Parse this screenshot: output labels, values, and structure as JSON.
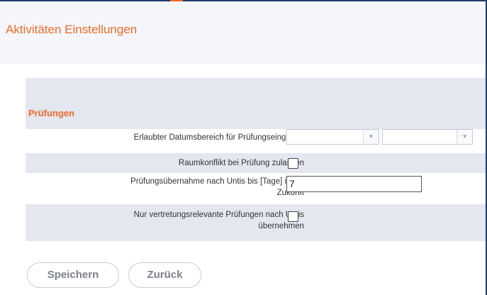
{
  "header": {
    "title": "Aktivitäten Einstellungen"
  },
  "section": {
    "title": "Prüfungen"
  },
  "rows": [
    {
      "label": "Erlaubter Datumsbereich für Prüfungseingaben",
      "control": "date-range",
      "from_value": "",
      "to_value": ""
    },
    {
      "label": "Raumkonflikt bei Prüfung zulassen",
      "control": "checkbox",
      "checked": false
    },
    {
      "label_line1": "Prüfungsübernahme nach Untis bis [Tage] in die",
      "label_line2": "Zukunft",
      "control": "text",
      "value": "7"
    },
    {
      "label_line1": "Nur vertretungsrelevante Prüfungen nach Untis",
      "label_line2": "übernehmen",
      "control": "checkbox",
      "checked": false
    }
  ],
  "buttons": {
    "save_label": "Speichern",
    "back_label": "Zurück"
  },
  "icons": {
    "dropdown": "chevron-down-icon",
    "dropdown_glyph": "▼"
  },
  "colors": {
    "accent": "#f06a2a",
    "section_bg": "#e4e7ef",
    "header_bg": "#f5f6f9",
    "frame": "#1f3a6b"
  }
}
